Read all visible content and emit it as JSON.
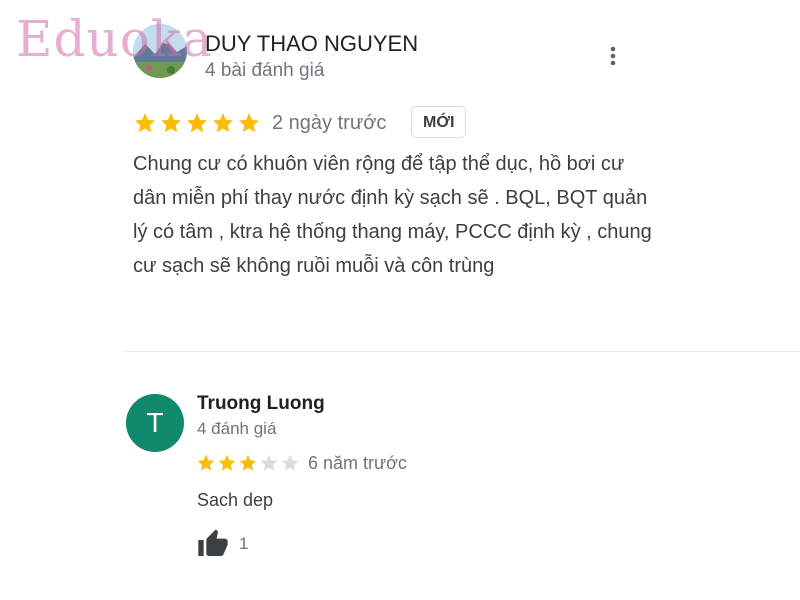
{
  "watermark": {
    "text": "Eduoka",
    "color": "#d26eaa"
  },
  "reviews": [
    {
      "author": "DUY THAO NGUYEN",
      "review_count": "4 bài đánh giá",
      "rating": 5,
      "max_rating": 5,
      "time": "2 ngày trước",
      "badge": "MỚI",
      "text": "Chung cư có khuôn viên rộng để tập thể dục, hồ bơi cư dân miễn phí thay nước định kỳ sạch sẽ . BQL, BQT quản lý có tâm , ktra hệ thống thang máy, PCCC định kỳ , chung cư sạch sẽ không ruồi muỗi và côn trùng",
      "avatar_icon": "landscape-photo-avatar",
      "menu_icon": "more-vert-icon"
    },
    {
      "author": "Truong Luong",
      "avatar_letter": "T",
      "avatar_color": "#10896c",
      "review_count": "4 đánh giá",
      "rating": 3,
      "max_rating": 5,
      "time": "6 năm trước",
      "text": "Sach dep",
      "likes": "1",
      "like_icon": "thumbs-up-icon"
    }
  ],
  "colors": {
    "star_filled": "#fbbc04",
    "star_empty": "#dadce0",
    "secondary_text": "#70757a"
  }
}
